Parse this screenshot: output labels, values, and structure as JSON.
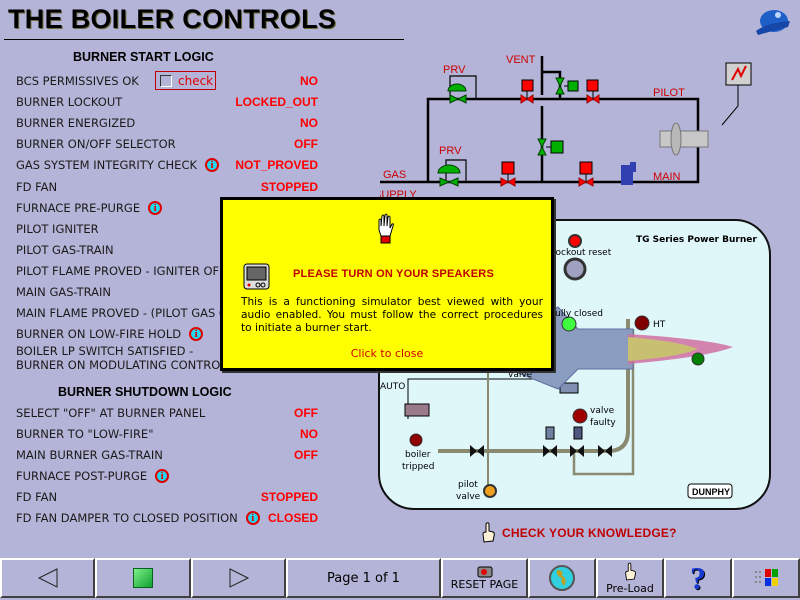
{
  "header": {
    "title": "THE BOILER CONTROLS",
    "logo_icon": "hard-hat-icon"
  },
  "start_logic": {
    "heading": "BURNER START LOGIC",
    "check_label": "check",
    "rows": [
      {
        "label": "BCS PERMISSIVES OK",
        "value": "NO",
        "info": false
      },
      {
        "label": "BURNER LOCKOUT",
        "value": "LOCKED_OUT",
        "info": false
      },
      {
        "label": "BURNER ENERGIZED",
        "value": "NO",
        "info": false
      },
      {
        "label": "BURNER ON/OFF SELECTOR",
        "value": "OFF",
        "info": false
      },
      {
        "label": "GAS SYSTEM INTEGRITY CHECK",
        "value": "NOT_PROVED",
        "info": true
      },
      {
        "label": "FD FAN",
        "value": "STOPPED",
        "info": false
      },
      {
        "label": "FURNACE PRE-PURGE",
        "value": "",
        "info": true
      },
      {
        "label": "PILOT IGNITER",
        "value": "",
        "info": false
      },
      {
        "label": "PILOT GAS-TRAIN",
        "value": "",
        "info": false
      },
      {
        "label": "PILOT FLAME PROVED - IGNITER OFF",
        "value": "",
        "info": false
      },
      {
        "label": "MAIN GAS-TRAIN",
        "value": "",
        "info": false
      },
      {
        "label": "MAIN FLAME PROVED - (PILOT GAS OFF)",
        "value": "",
        "info": false
      },
      {
        "label": "BURNER ON LOW-FIRE HOLD",
        "value": "",
        "info": true
      },
      {
        "label": "BOILER LP SWITCH SATISFIED -",
        "label2": "BURNER ON MODULATING CONTROL",
        "value": "",
        "info": false
      }
    ]
  },
  "shutdown_logic": {
    "heading": "BURNER SHUTDOWN LOGIC",
    "rows": [
      {
        "label": "SELECT \"OFF\" AT BURNER PANEL",
        "value": "OFF",
        "info": false
      },
      {
        "label": "BURNER TO \"LOW-FIRE\"",
        "value": "NO",
        "info": false
      },
      {
        "label": "MAIN BURNER GAS-TRAIN",
        "value": "OFF",
        "info": false
      },
      {
        "label": "FURNACE POST-PURGE",
        "value": "",
        "info": true
      },
      {
        "label": "FD FAN",
        "value": "STOPPED",
        "info": false
      },
      {
        "label": "FD FAN DAMPER TO CLOSED POSITION",
        "value": "CLOSED",
        "info": true
      }
    ]
  },
  "schematic": {
    "labels": {
      "vent": "VENT",
      "prv_top": "PRV",
      "prv_bottom": "PRV",
      "pilot": "PILOT",
      "main": "MAIN",
      "gas": "GAS",
      "supply": "SUPPLY"
    },
    "colors": {
      "open_valve": "#00b000",
      "closed_valve": "#ff0000",
      "pipe": "#000000",
      "label": "#cc0000"
    }
  },
  "burner_panel": {
    "title": "TG Series Power Burner",
    "labels": {
      "lockout_reset": "lockout reset",
      "fully_closed": "fully closed",
      "ht": "HT",
      "auto": "AUTO",
      "valve": "valve",
      "valve_faulty_1": "valve",
      "valve_faulty_2": "faulty",
      "boiler_tripped_1": "boiler",
      "boiler_tripped_2": "tripped",
      "pilot_valve_1": "pilot",
      "pilot_valve_2": "valve",
      "brand": "DUNPHY"
    }
  },
  "popup": {
    "title": "PLEASE TURN ON YOUR SPEAKERS",
    "body": "This is a functioning simulator best viewed with your audio enabled. You must follow the correct procedures to initiate a burner start.",
    "close_label": "Click to close"
  },
  "check_knowledge": {
    "label": "CHECK YOUR KNOWLEDGE?"
  },
  "nav": {
    "page_indicator": "Page 1 of 1",
    "reset_label": "RESET PAGE",
    "preload_label": "Pre-Load"
  }
}
